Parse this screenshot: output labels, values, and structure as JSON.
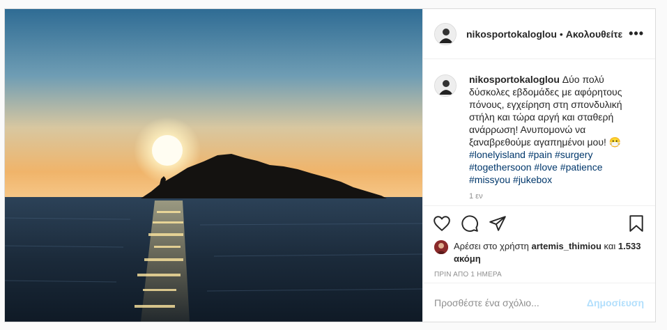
{
  "post": {
    "username": "nikosportokaloglou",
    "separator": "•",
    "follow_label": "Ακολουθείτε",
    "more_label": "•••",
    "caption_user": "nikosportokaloglou",
    "caption_text": "Δύο πολύ δύσκολες εβδομάδες με αφόρητους πόνους, εγχείρηση στη σπονδυλική στήλη και τώρα αργή και σταθερή ανάρρωση! Ανυπομονώ να ξαναβρεθούμε αγαπημένοι μου! 😷",
    "hashtags": [
      "#lonelyisland",
      "#pain",
      "#surgery",
      "#togethersoon",
      "#love",
      "#patience",
      "#missyou",
      "#jukebox"
    ],
    "comment_time": "1 εν",
    "likes_prefix": "Αρέσει στο χρήστη",
    "likes_user": "artemis_thimiou",
    "likes_and": "και",
    "likes_more": "1.533 ακόμη",
    "date": "ΠΡΙΝ ΑΠΟ 1 ΗΜΕΡΑ",
    "comment_placeholder": "Προσθέστε ένα σχόλιο...",
    "publish_label": "Δημοσίευση"
  },
  "icons": {
    "like": "heart-icon",
    "comment": "comment-icon",
    "share": "paper-plane-icon",
    "save": "bookmark-icon"
  },
  "colors": {
    "link": "#00376b",
    "publish": "#b2dffc",
    "muted": "#8e8e8e"
  }
}
